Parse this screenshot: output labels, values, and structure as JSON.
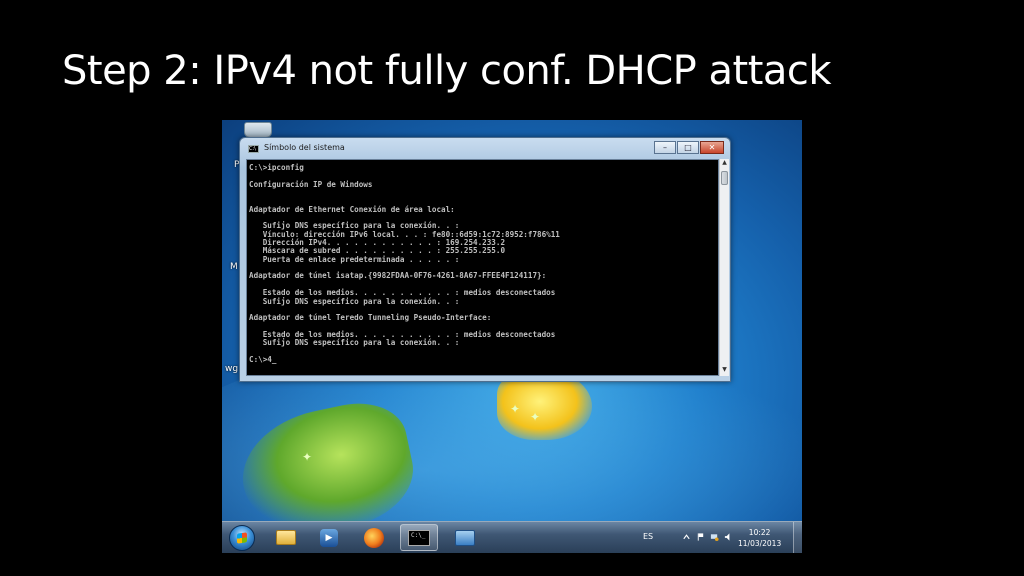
{
  "slide": {
    "title": "Step 2: IPv4 not fully conf. DHCP attack"
  },
  "desktop": {
    "label_fragments": [
      "P",
      "M",
      "wg"
    ]
  },
  "cmd": {
    "window_title": "Símbolo del sistema",
    "buttons": {
      "minimize": "–",
      "maximize": "□",
      "close": "✕"
    },
    "lines": [
      "C:\\>ipconfig",
      "",
      "Configuración IP de Windows",
      "",
      "",
      "Adaptador de Ethernet Conexión de área local:",
      "",
      "   Sufijo DNS específico para la conexión. . :",
      "   Vínculo: dirección IPv6 local. . . : fe80::6d59:1c72:8952:f786%11",
      "   Dirección IPv4. . . . . . . . . . . . : 169.254.233.2",
      "   Máscara de subred . . . . . . . . . . : 255.255.255.0",
      "   Puerta de enlace predeterminada . . . . . :",
      "",
      "Adaptador de túnel isatap.{9982FDAA-0F76-4261-8A67-FFEE4F124117}:",
      "",
      "   Estado de los medios. . . . . . . . . . . : medios desconectados",
      "   Sufijo DNS específico para la conexión. . :",
      "",
      "Adaptador de túnel Teredo Tunneling Pseudo-Interface:",
      "",
      "   Estado de los medios. . . . . . . . . . . : medios desconectados",
      "   Sufijo DNS específico para la conexión. . :",
      "",
      "C:\\>4"
    ]
  },
  "taskbar": {
    "language": "ES",
    "time": "10:22",
    "date": "11/03/2013",
    "icons": [
      "start-orb",
      "explorer-icon",
      "media-player-icon",
      "firefox-icon",
      "cmd-icon",
      "network-icon"
    ]
  },
  "colors": {
    "slide_bg": "#000000",
    "title_text": "#ffffff",
    "console_bg": "#000000",
    "console_text": "#c0c0c0"
  }
}
